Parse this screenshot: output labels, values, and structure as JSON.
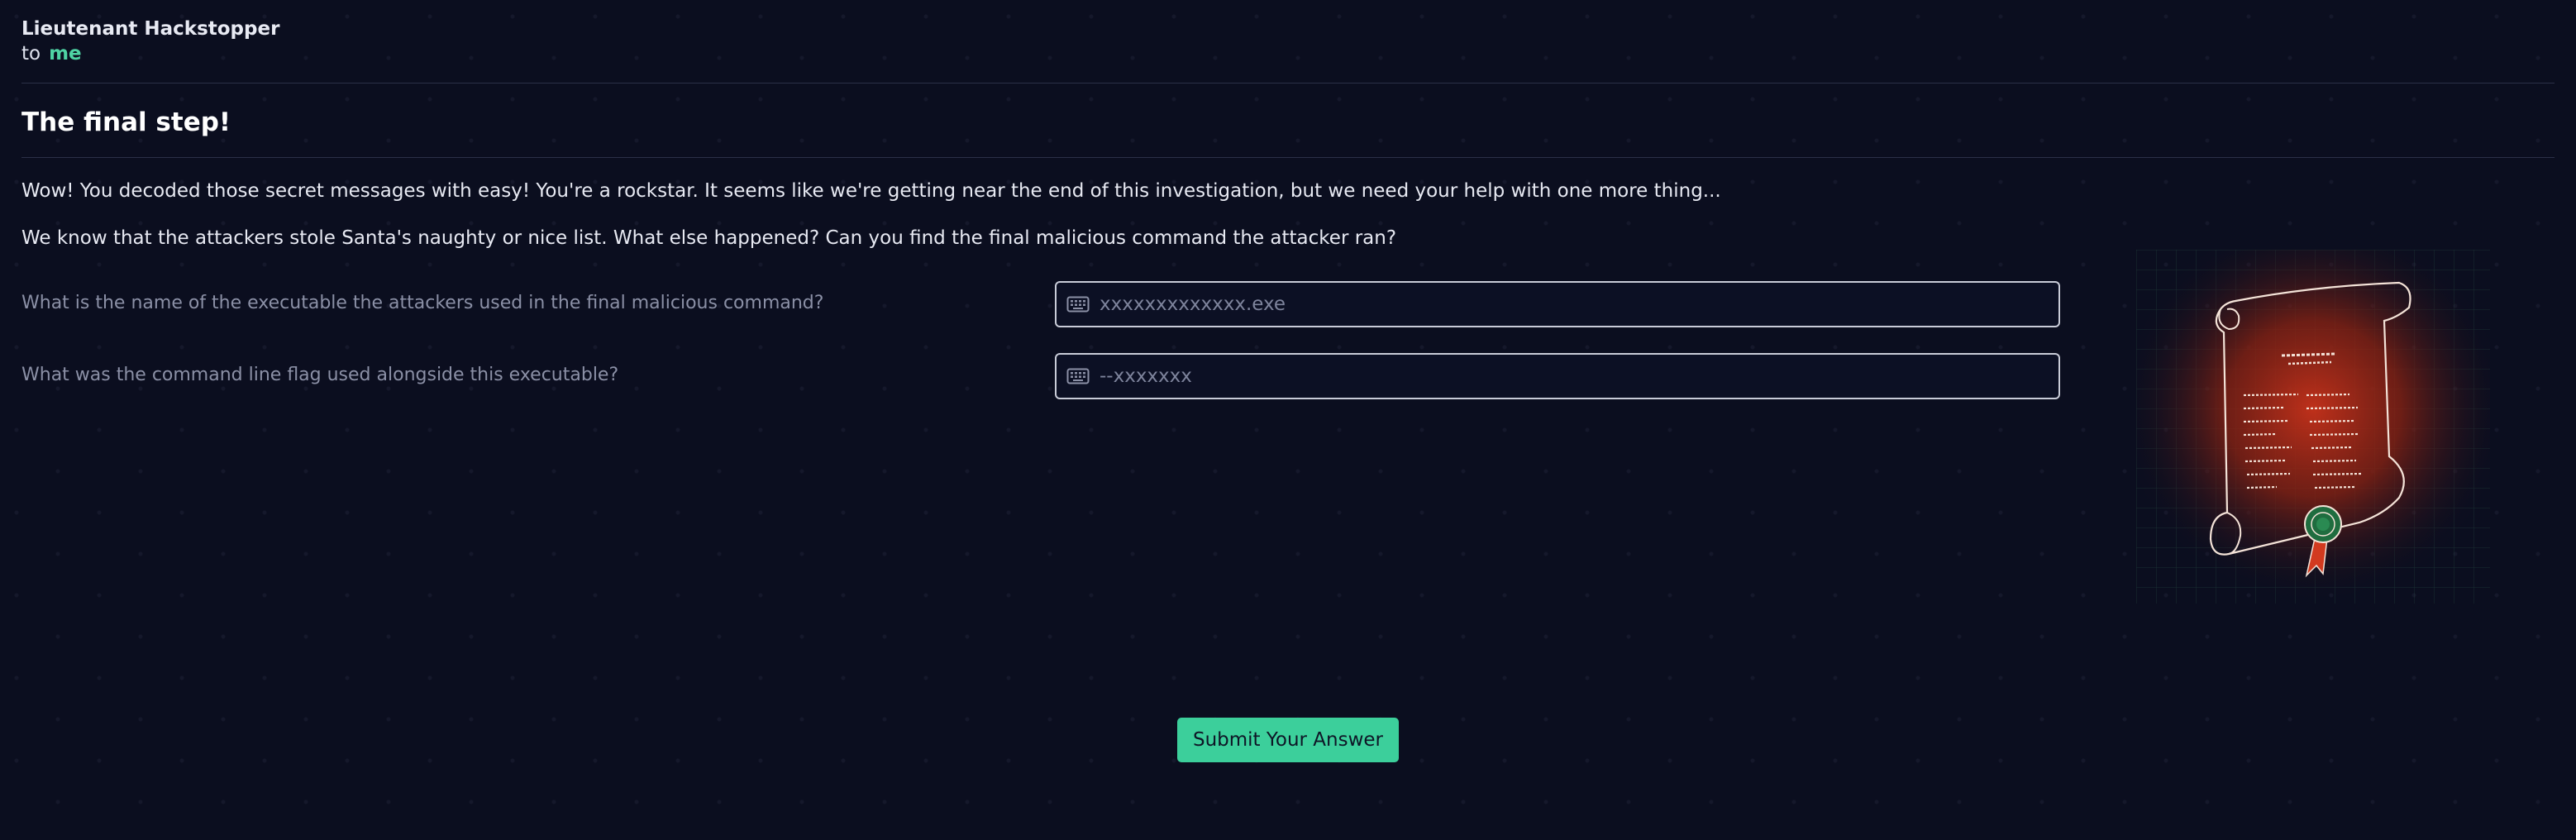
{
  "email": {
    "sender": "Lieutenant Hackstopper",
    "to_prefix": "to",
    "recipient": "me",
    "subject": "The final step!",
    "paragraphs": [
      "Wow! You decoded those secret messages with easy! You're a rockstar. It seems like we're getting near the end of this investigation, but we need your help with one more thing...",
      "We know that the attackers stole Santa's naughty or nice list. What else happened? Can you find the final malicious command the attacker ran?"
    ]
  },
  "questions": [
    {
      "label": "What is the name of the executable the attackers used in the final malicious command?",
      "placeholder": "xxxxxxxxxxxxx.exe",
      "value": ""
    },
    {
      "label": "What was the command line flag used alongside this executable?",
      "placeholder": "--xxxxxxx",
      "value": ""
    }
  ],
  "submit_label": "Submit Your Answer",
  "illustration": {
    "icon": "scroll-list-icon",
    "glow_color": "#c8321a"
  },
  "colors": {
    "background": "#0b0e1f",
    "accent": "#3ccf9b",
    "recipient": "#4fd3a4"
  }
}
